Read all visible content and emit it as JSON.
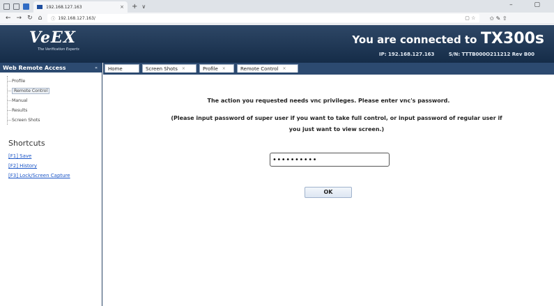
{
  "browser": {
    "tab_title": "192.168.127.163",
    "tab_close": "×",
    "new_tab": "+",
    "tab_list": "∨",
    "window_controls": "– ▢",
    "url": "192.168.127.163/",
    "nav_back": "←",
    "nav_forward": "→",
    "nav_refresh": "↻",
    "nav_home": "⌂",
    "site_info": "ⓘ",
    "addr_tools": "▢ ☆",
    "toolbar_icons": "✩ ✎ ⇧"
  },
  "header": {
    "logo_text": "VeEX",
    "logo_tagline": "The Verification Experts",
    "connected_prefix": "You are connected to",
    "model": "TX300s",
    "ip": "IP: 192.168.127.163",
    "serial": "S/N: TTTB000O211212 Rev B00"
  },
  "sidebar": {
    "title": "Web Remote Access",
    "collapse_glyph": "«",
    "items": [
      {
        "label": "Profile"
      },
      {
        "label": "Remote Control"
      },
      {
        "label": "Manual"
      },
      {
        "label": "Results"
      },
      {
        "label": "Screen Shots"
      }
    ],
    "shortcuts_title": "Shortcuts",
    "shortcuts": [
      {
        "label": "[F1] Save"
      },
      {
        "label": "[F2] History"
      },
      {
        "label": "[F3] Lock/Screen Capture"
      }
    ]
  },
  "tabs": [
    {
      "label": "Home"
    },
    {
      "label": "Screen Shots",
      "close": "×"
    },
    {
      "label": "Profile",
      "close": "×"
    },
    {
      "label": "Remote Control",
      "close": "×"
    }
  ],
  "main": {
    "message": "The action you requested needs vnc privileges. Please enter vnc's password.",
    "hint": "(Please input password of super user if you want to take full control, or input password of regular user if you just want to view screen.)",
    "password_value": "••••••••••",
    "ok_label": "OK"
  }
}
